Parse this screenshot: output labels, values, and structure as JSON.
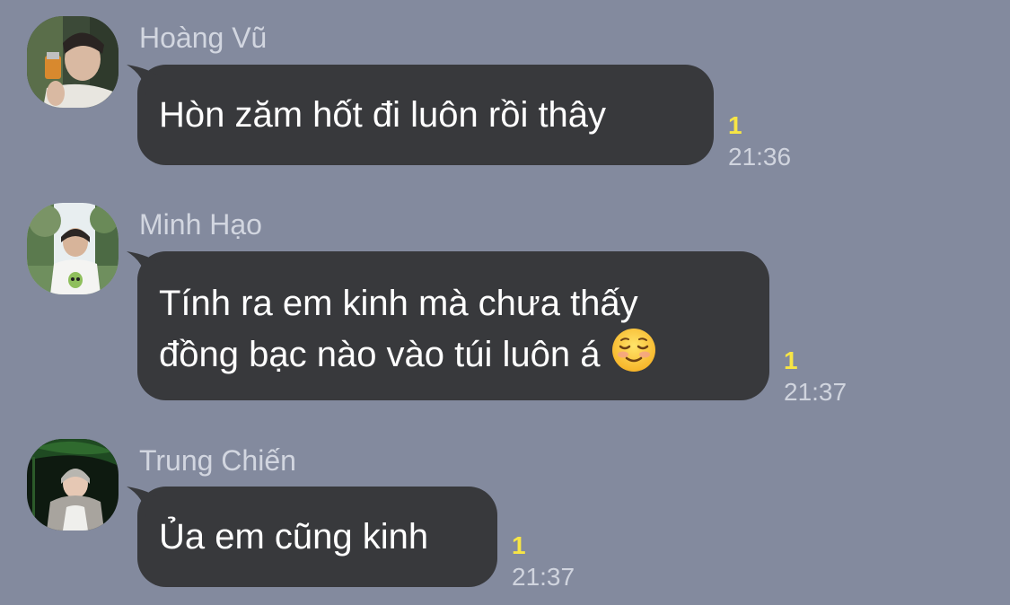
{
  "colors": {
    "background": "#838a9e",
    "bubble": "#38393c",
    "unread": "#f7e545",
    "meta_text": "#d0d4de"
  },
  "messages": [
    {
      "sender": "Hoàng Vũ",
      "avatar_icon": "avatar-hoang-vu-icon",
      "text": "Hòn zăm hốt đi luôn rồi thây",
      "unread": "1",
      "time": "21:36"
    },
    {
      "sender": "Minh Hạo",
      "avatar_icon": "avatar-minh-hao-icon",
      "text_line1": "Tính ra em kinh mà chưa thấy",
      "text_line2": "đồng bạc nào vào túi luôn á",
      "emoji": "smiling-face-icon",
      "unread": "1",
      "time": "21:37"
    },
    {
      "sender": "Trung Chiến",
      "avatar_icon": "avatar-trung-chien-icon",
      "text": "Ủa em cũng kinh",
      "unread": "1",
      "time": "21:37"
    }
  ]
}
